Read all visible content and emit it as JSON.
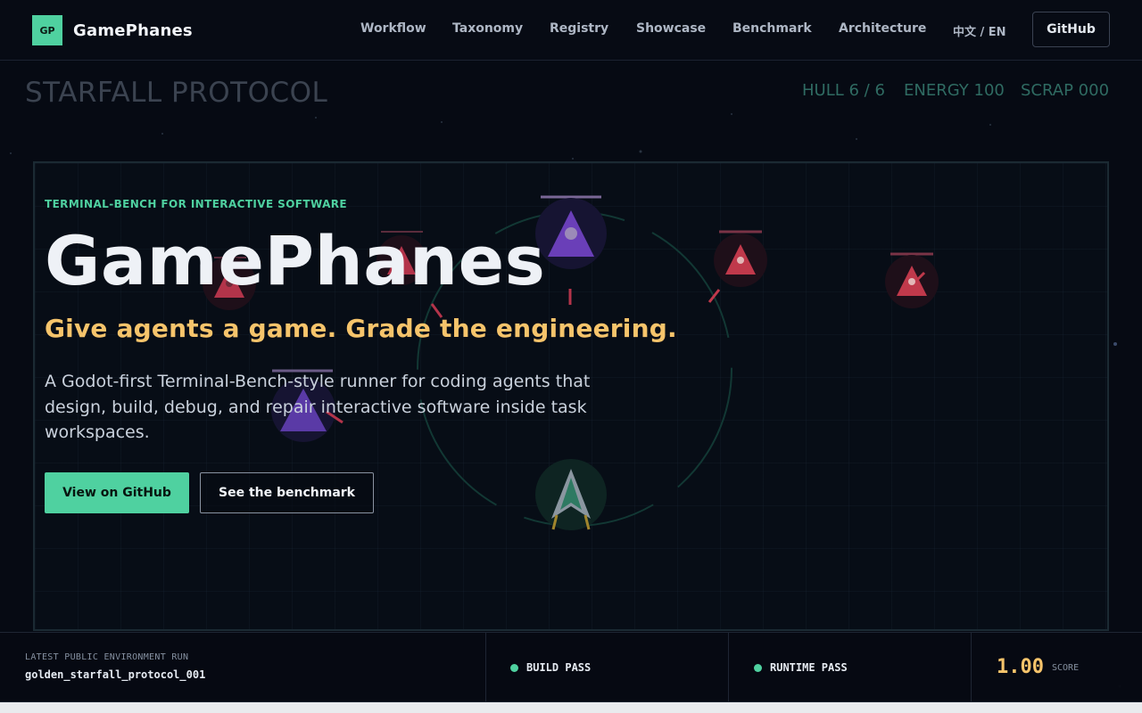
{
  "brand": {
    "logo": "GP",
    "name": "GamePhanes"
  },
  "nav": {
    "links": [
      "Workflow",
      "Taxonomy",
      "Registry",
      "Showcase",
      "Benchmark",
      "Architecture"
    ],
    "language": "中文 / EN",
    "github": "GitHub"
  },
  "game": {
    "title": "STARFALL PROTOCOL",
    "hud": {
      "hull": "HULL 6 / 6",
      "energy": "ENERGY 100",
      "scrap": "SCRAP 000"
    },
    "colors": {
      "enemy": "#c0394b",
      "elite": "#6a3fb8",
      "player": "#3f8a72",
      "ring": "#133a36"
    }
  },
  "hero": {
    "eyebrow": "TERMINAL-BENCH FOR INTERACTIVE SOFTWARE",
    "title": "GamePhanes",
    "tagline": "Give agents a game. Grade the engineering.",
    "description": "A Godot-first Terminal-Bench-style runner for coding agents that design, build, debug, and repair interactive software inside task workspaces.",
    "primary_button": "View on GitHub",
    "secondary_button": "See the benchmark"
  },
  "status": {
    "run_label": "LATEST PUBLIC ENVIRONMENT RUN",
    "run_id": "golden_starfall_protocol_001",
    "build": "BUILD PASS",
    "runtime": "RUNTIME PASS",
    "score": "1.00",
    "score_label": "SCORE"
  },
  "colors": {
    "accent": "#4fd1a0",
    "highlight": "#f6c46b",
    "background": "#060a13"
  }
}
